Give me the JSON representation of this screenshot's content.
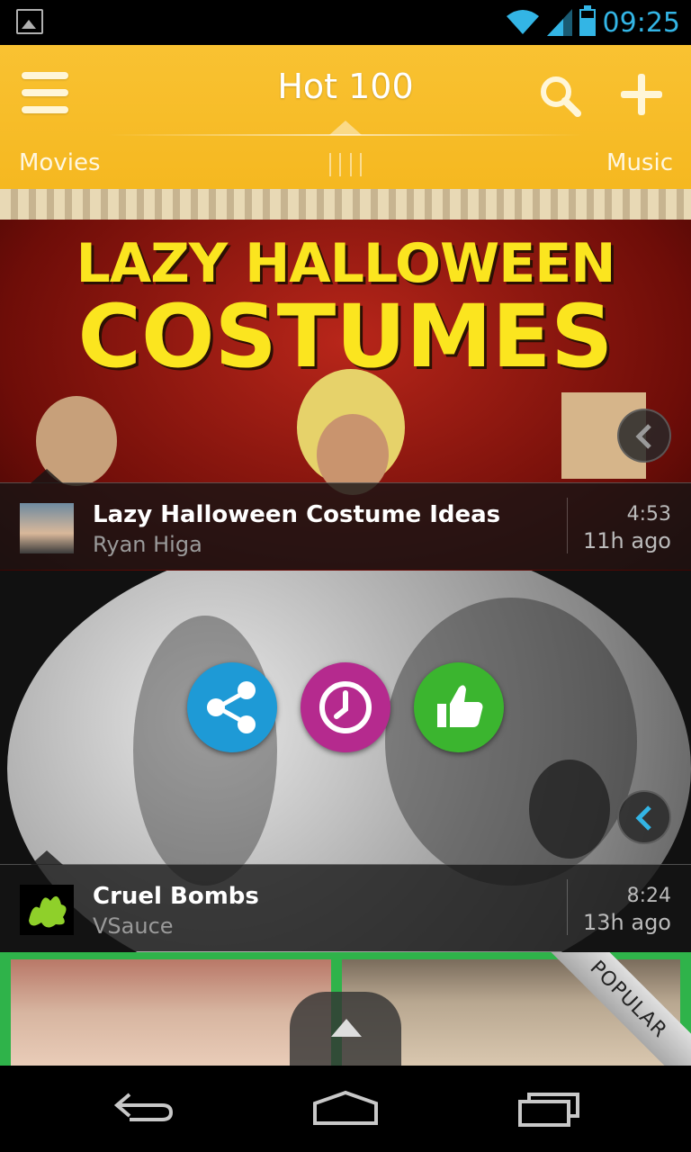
{
  "status_bar": {
    "time": "09:25"
  },
  "header": {
    "title": "Hot 100",
    "tab_left": "Movies",
    "tab_right": "Music"
  },
  "videos": [
    {
      "thumbnail_text_line1": "LAZY HALLOWEEN",
      "thumbnail_text_line2": "COSTUMES",
      "title": "Lazy Halloween Costume Ideas",
      "author": "Ryan Higa",
      "duration": "4:53",
      "age": "11h ago"
    },
    {
      "title": "Cruel Bombs",
      "author": "VSauce",
      "duration": "8:24",
      "age": "13h ago"
    }
  ],
  "badge": "POPULAR",
  "colors": {
    "header": "#f7bd27",
    "share": "#1e9ad6",
    "watch_later": "#b52a8e",
    "like": "#3bb52f",
    "status_accent": "#33b5e5"
  }
}
